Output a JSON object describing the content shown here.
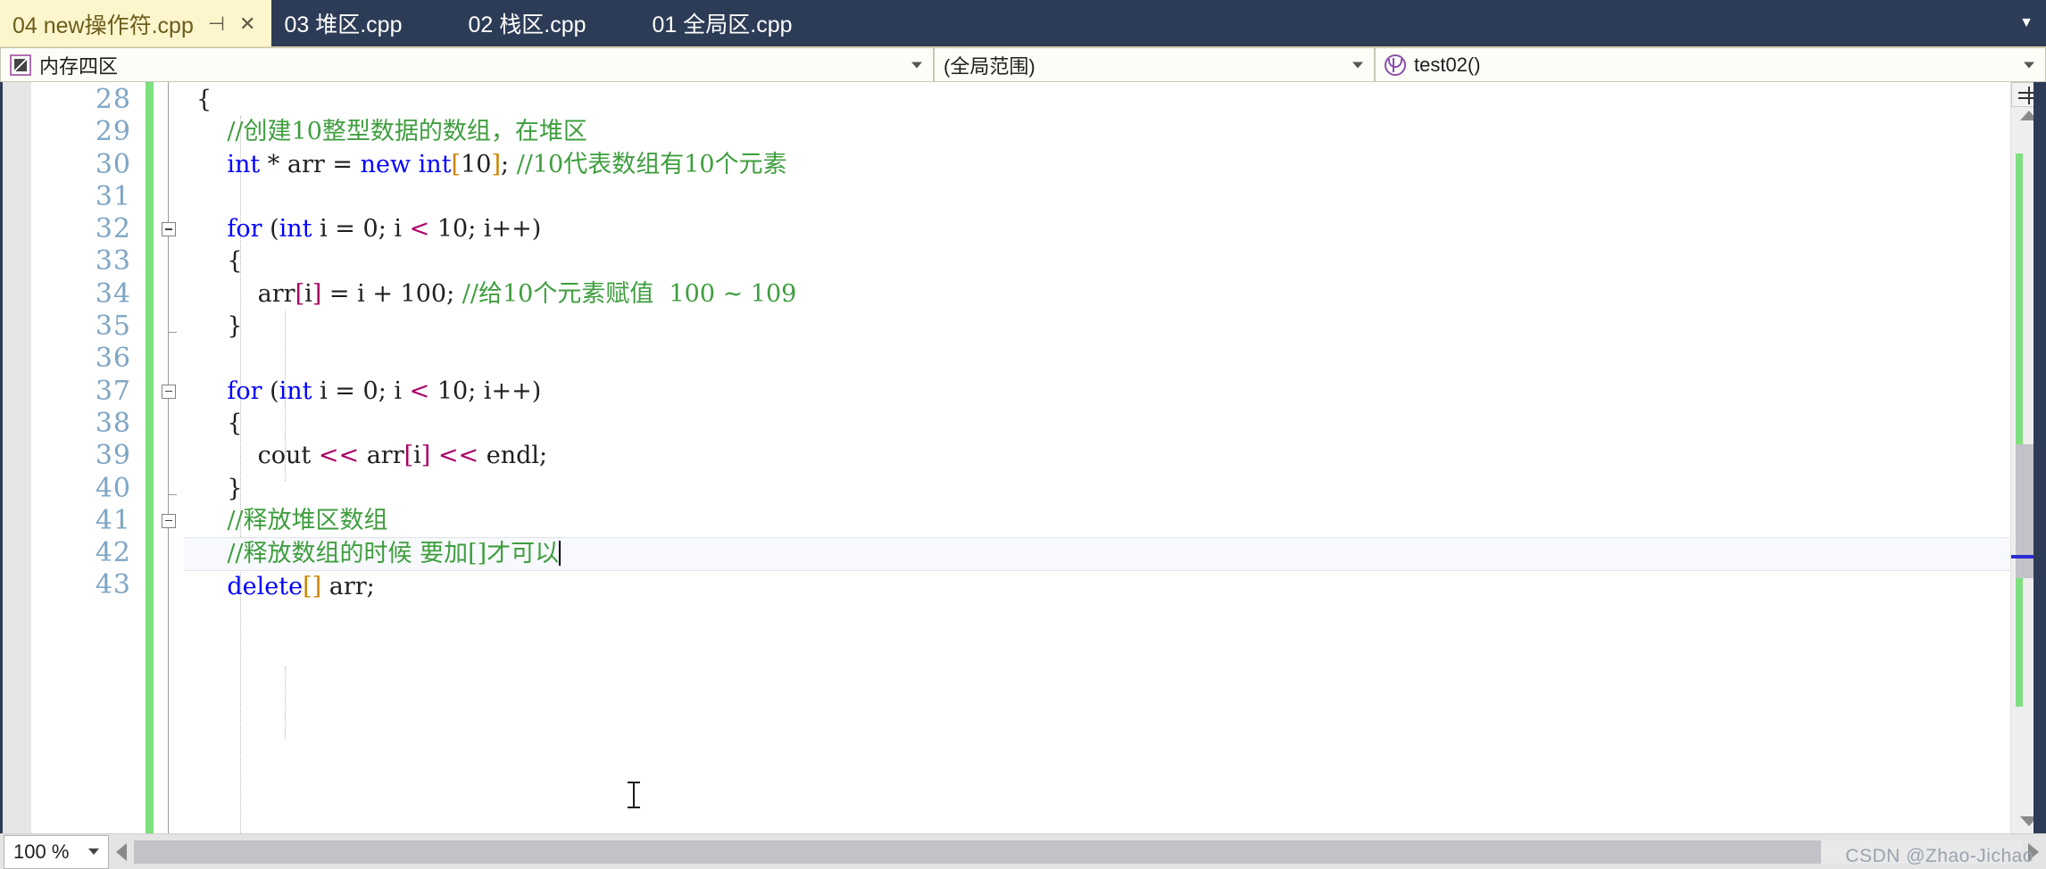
{
  "window": {
    "accent_tab_active_bg": "#fdf6cd",
    "chrome_bg": "#2d3c56"
  },
  "tabs": {
    "items": [
      {
        "label": "04 new操作符.cpp",
        "active": true,
        "pin_icon": "pin-icon",
        "close_icon": "close-icon"
      },
      {
        "label": "03 堆区.cpp",
        "active": false
      },
      {
        "label": "02 栈区.cpp",
        "active": false
      },
      {
        "label": "01 全局区.cpp",
        "active": false
      }
    ],
    "overflow_icon": "chevron-down-icon"
  },
  "navbar": {
    "project": {
      "icon": "memory-region-icon",
      "value": "内存四区",
      "caret": "chevron-down-icon"
    },
    "scope": {
      "value": "(全局范围)",
      "caret": "chevron-down-icon"
    },
    "member": {
      "icon": "method-icon",
      "value": "test02()",
      "caret": "chevron-down-icon"
    }
  },
  "editor": {
    "first_line": 28,
    "current_line": 42,
    "lines": [
      {
        "n": 28,
        "fold": "none",
        "tokens": [
          {
            "t": "{",
            "c": "plain"
          }
        ]
      },
      {
        "n": 29,
        "fold": "none",
        "indent": 1,
        "tokens": [
          {
            "t": "    //创建10整型数据的数组，在堆区",
            "c": "cmt"
          }
        ]
      },
      {
        "n": 30,
        "fold": "none",
        "indent": 1,
        "tokens": [
          {
            "t": "    ",
            "c": "plain"
          },
          {
            "t": "int",
            "c": "kw"
          },
          {
            "t": " * arr = ",
            "c": "plain"
          },
          {
            "t": "new",
            "c": "kw"
          },
          {
            "t": " ",
            "c": "plain"
          },
          {
            "t": "int",
            "c": "kw"
          },
          {
            "t": "[",
            "c": "brk"
          },
          {
            "t": "10",
            "c": "num"
          },
          {
            "t": "]",
            "c": "brk"
          },
          {
            "t": "; ",
            "c": "plain"
          },
          {
            "t": "//10代表数组有10个元素",
            "c": "cmt"
          }
        ]
      },
      {
        "n": 31,
        "fold": "none",
        "tokens": []
      },
      {
        "n": 32,
        "fold": "box",
        "indent": 1,
        "tokens": [
          {
            "t": "    ",
            "c": "plain"
          },
          {
            "t": "for",
            "c": "kw"
          },
          {
            "t": " (",
            "c": "plain"
          },
          {
            "t": "int",
            "c": "kw"
          },
          {
            "t": " i = ",
            "c": "plain"
          },
          {
            "t": "0",
            "c": "num"
          },
          {
            "t": "; i ",
            "c": "plain"
          },
          {
            "t": "<",
            "c": "brkp"
          },
          {
            "t": " ",
            "c": "plain"
          },
          {
            "t": "10",
            "c": "num"
          },
          {
            "t": "; i++)",
            "c": "plain"
          }
        ]
      },
      {
        "n": 33,
        "fold": "none",
        "indent": 1,
        "tokens": [
          {
            "t": "    {",
            "c": "plain"
          }
        ]
      },
      {
        "n": 34,
        "fold": "none",
        "indent": 2,
        "tokens": [
          {
            "t": "        arr",
            "c": "plain"
          },
          {
            "t": "[",
            "c": "brkp"
          },
          {
            "t": "i",
            "c": "plain"
          },
          {
            "t": "]",
            "c": "brkp"
          },
          {
            "t": " = i + ",
            "c": "plain"
          },
          {
            "t": "100",
            "c": "num"
          },
          {
            "t": "; ",
            "c": "plain"
          },
          {
            "t": "//给10个元素赋值  100 ~ 109",
            "c": "cmt"
          }
        ]
      },
      {
        "n": 35,
        "fold": "end",
        "indent": 1,
        "tokens": [
          {
            "t": "    }",
            "c": "plain"
          }
        ]
      },
      {
        "n": 36,
        "fold": "none",
        "tokens": []
      },
      {
        "n": 37,
        "fold": "box",
        "indent": 1,
        "tokens": [
          {
            "t": "    ",
            "c": "plain"
          },
          {
            "t": "for",
            "c": "kw"
          },
          {
            "t": " (",
            "c": "plain"
          },
          {
            "t": "int",
            "c": "kw"
          },
          {
            "t": " i = ",
            "c": "plain"
          },
          {
            "t": "0",
            "c": "num"
          },
          {
            "t": "; i ",
            "c": "plain"
          },
          {
            "t": "<",
            "c": "brkp"
          },
          {
            "t": " ",
            "c": "plain"
          },
          {
            "t": "10",
            "c": "num"
          },
          {
            "t": "; i++)",
            "c": "plain"
          }
        ]
      },
      {
        "n": 38,
        "fold": "none",
        "indent": 1,
        "tokens": [
          {
            "t": "    {",
            "c": "plain"
          }
        ]
      },
      {
        "n": 39,
        "fold": "none",
        "indent": 2,
        "tokens": [
          {
            "t": "        cout ",
            "c": "plain"
          },
          {
            "t": "<<",
            "c": "brkp"
          },
          {
            "t": " arr",
            "c": "plain"
          },
          {
            "t": "[",
            "c": "brkp"
          },
          {
            "t": "i",
            "c": "plain"
          },
          {
            "t": "]",
            "c": "brkp"
          },
          {
            "t": " ",
            "c": "plain"
          },
          {
            "t": "<<",
            "c": "brkp"
          },
          {
            "t": " endl;",
            "c": "plain"
          }
        ]
      },
      {
        "n": 40,
        "fold": "end",
        "indent": 1,
        "tokens": [
          {
            "t": "    }",
            "c": "plain"
          }
        ]
      },
      {
        "n": 41,
        "fold": "box",
        "indent": 1,
        "tokens": [
          {
            "t": "    //释放堆区数组",
            "c": "cmt"
          }
        ]
      },
      {
        "n": 42,
        "fold": "none",
        "indent": 1,
        "current": true,
        "tokens": [
          {
            "t": "    //释放数组的时候 要加[]才可以",
            "c": "cmt"
          }
        ]
      },
      {
        "n": 43,
        "fold": "none",
        "indent": 1,
        "tokens": [
          {
            "t": "    ",
            "c": "plain"
          },
          {
            "t": "delete",
            "c": "kw"
          },
          {
            "t": "[",
            "c": "brk"
          },
          {
            "t": "]",
            "c": "brk"
          },
          {
            "t": " arr;",
            "c": "plain"
          }
        ]
      }
    ]
  },
  "scrollbar": {
    "splitter_icon": "split-view-icon",
    "up_arrow_icon": "scroll-up-icon",
    "down_arrow_icon": "scroll-down-icon",
    "change_marker_color": "#7ee07e",
    "cursor_marker_color": "#2b2bd4"
  },
  "statusbar": {
    "zoom": "100 %",
    "zoom_caret": "chevron-down-icon",
    "hscroll_left_icon": "scroll-left-icon",
    "hscroll_right_icon": "scroll-right-icon",
    "watermark": "CSDN @Zhao-Jichao"
  }
}
